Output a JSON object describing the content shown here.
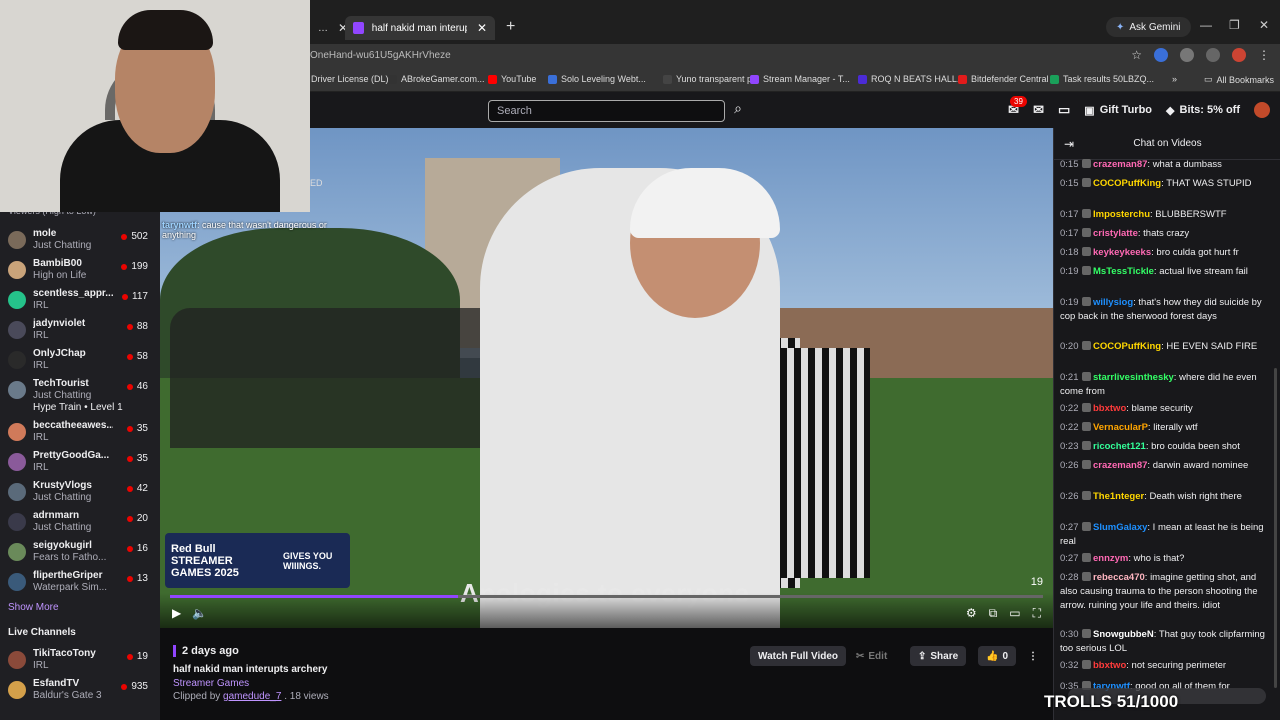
{
  "browser": {
    "active_tab": "half nakid man interupts archery",
    "new_tab": "+",
    "ask_gemini": "Ask Gemini",
    "url": "OneHand-wu61U5gAKHrVheze",
    "bookmarks": [
      {
        "label": "Driver License (DL)...",
        "color": "#888"
      },
      {
        "label": "ABrokeGamer.com...",
        "color": "#333"
      },
      {
        "label": "YouTube",
        "color": "#ff0000"
      },
      {
        "label": "Solo Leveling Webt...",
        "color": "#3a6fd8"
      },
      {
        "label": "Yuno transparent p...",
        "color": "#444"
      },
      {
        "label": "Stream Manager - T...",
        "color": "#9146ff"
      },
      {
        "label": "ROQ N BEATS HALL...",
        "color": "#4b2bd6"
      },
      {
        "label": "Bitdefender Central",
        "color": "#e21b1b"
      },
      {
        "label": "Task results 50LBZQ...",
        "color": "#1aa05a"
      }
    ],
    "all_bookmarks": "All Bookmarks"
  },
  "header": {
    "search_placeholder": "Search",
    "notif_count": "39",
    "gift_turbo": "Gift Turbo",
    "bits": "Bits: 5% off"
  },
  "sidebar": {
    "viewers_header": "Viewers (High to Low)",
    "channels": [
      {
        "name": "mole",
        "category": "Just Chatting",
        "viewers": "502",
        "color": "#7a6a5a"
      },
      {
        "name": "BambiB00",
        "category": "High on Life",
        "viewers": "199",
        "color": "#c9a37a"
      },
      {
        "name": "scentless_appr...",
        "category": "IRL",
        "viewers": "117",
        "color": "#25c28a"
      },
      {
        "name": "jadynviolet",
        "category": "IRL",
        "viewers": "88",
        "color": "#4a4a5a"
      },
      {
        "name": "OnlyJChap",
        "category": "IRL",
        "viewers": "58",
        "color": "#2a2a2a"
      },
      {
        "name": "TechTourist",
        "category": "Just Chatting",
        "viewers": "46",
        "color": "#6a7a8a"
      },
      {
        "name": "beccatheeawes...",
        "category": "IRL",
        "viewers": "35",
        "color": "#d07a5a"
      },
      {
        "name": "PrettyGoodGa...",
        "category": "IRL",
        "viewers": "35",
        "color": "#8a5a9a"
      },
      {
        "name": "KrustyVlogs",
        "category": "Just Chatting",
        "viewers": "42",
        "color": "#5a6a7a"
      },
      {
        "name": "adrnmarn",
        "category": "Just Chatting",
        "viewers": "20",
        "color": "#3a3a4a"
      },
      {
        "name": "seigyokugirl",
        "category": "Fears to Fatho...",
        "viewers": "16",
        "color": "#6a8a5a"
      },
      {
        "name": "flipertheGriper",
        "category": "Waterpark Sim...",
        "viewers": "13",
        "color": "#3a5a7a"
      }
    ],
    "hype_train": "Hype Train • Level 1",
    "show_more": "Show More",
    "live_channels": "Live Channels",
    "live": [
      {
        "name": "TikiTacoTony",
        "category": "IRL",
        "viewers": "19",
        "color": "#8a4a3a"
      },
      {
        "name": "EsfandTV",
        "category": "Baldur's Gate 3",
        "viewers": "935",
        "color": "#d4a04a"
      }
    ]
  },
  "video": {
    "caption": "Apologies to everyone",
    "counter": "19",
    "progress": 0.33,
    "overlay_user": "tarynwtf",
    "overlay_msg": "cause that wasn't dangerous or anything",
    "ed_badge": "ED",
    "sponsor_left": "Red Bull STREAMER GAMES 2025",
    "sponsor_right": "GIVES YOU WIIINGS."
  },
  "clip": {
    "ago": "2 days ago",
    "title": "half nakid man interupts archery",
    "game": "Streamer Games",
    "clipped_by_prefix": "Clipped by",
    "clipper": "gamedude_7",
    "views": ". 18 views",
    "watch_full": "Watch Full Video",
    "edit": "Edit",
    "share": "Share",
    "likes": "0"
  },
  "chat": {
    "title": "Chat on Videos",
    "messages": [
      {
        "t": "0:15",
        "user": "crazeman87",
        "color": "#ff69b4",
        "text": "what a dumbass"
      },
      {
        "t": "0:15",
        "user": "COCOPuffKing",
        "color": "#ffd700",
        "text": "THAT WAS STUPID"
      },
      {
        "t": "0:17",
        "user": "Imposterchu",
        "color": "#ffd700",
        "text": "BLUBBERSWTF"
      },
      {
        "t": "0:17",
        "user": "cristylatte",
        "color": "#ff69b4",
        "text": "thats crazy"
      },
      {
        "t": "0:18",
        "user": "keykeykeeks",
        "color": "#ff69b4",
        "text": "bro culda got hurt fr"
      },
      {
        "t": "0:19",
        "user": "MsTessTickle",
        "color": "#33ff66",
        "text": "actual live stream fail"
      },
      {
        "t": "0:19",
        "user": "willysiog",
        "color": "#1e90ff",
        "text": "that's how they did suicide by cop back in the sherwood forest days"
      },
      {
        "t": "0:20",
        "user": "COCOPuffKing",
        "color": "#ffd700",
        "text": "HE EVEN SAID FIRE"
      },
      {
        "t": "0:21",
        "user": "starrlivesinthesky",
        "color": "#33ff66",
        "text": "where did he even come from"
      },
      {
        "t": "0:22",
        "user": "bbxtwo",
        "color": "#ff3b3b",
        "text": "blame security"
      },
      {
        "t": "0:22",
        "user": "VernacularP",
        "color": "#ffa500",
        "text": "literally wtf"
      },
      {
        "t": "0:23",
        "user": "ricochet121",
        "color": "#33ff99",
        "text": "bro coulda been shot"
      },
      {
        "t": "0:26",
        "user": "crazeman87",
        "color": "#ff69b4",
        "text": "darwin award nominee"
      },
      {
        "t": "0:26",
        "user": "The1nteger",
        "color": "#ffd700",
        "text": "Death wish right there"
      },
      {
        "t": "0:27",
        "user": "SlumGalaxy",
        "color": "#1e90ff",
        "text": "I mean at least he is being real"
      },
      {
        "t": "0:27",
        "user": "ennzym",
        "color": "#ff69b4",
        "text": "who is that?"
      },
      {
        "t": "0:28",
        "user": "rebecca470",
        "color": "#ffb6c1",
        "text": "imagine getting shot, and also causing trauma to the person shooting the arrow. ruining your life and theirs. idiot"
      },
      {
        "t": "0:30",
        "user": "SnowgubbeN",
        "color": "#ffffff",
        "text": "That guy took clipfarming too serious LOL"
      },
      {
        "t": "0:32",
        "user": "bbxtwo",
        "color": "#ff3b3b",
        "text": "not securing perimeter"
      },
      {
        "t": "0:35",
        "user": "tarynwtf",
        "color": "#1e90ff",
        "text": "good on all of them for"
      }
    ]
  },
  "overlay": {
    "trolls": "TROLLS 51/1000"
  }
}
